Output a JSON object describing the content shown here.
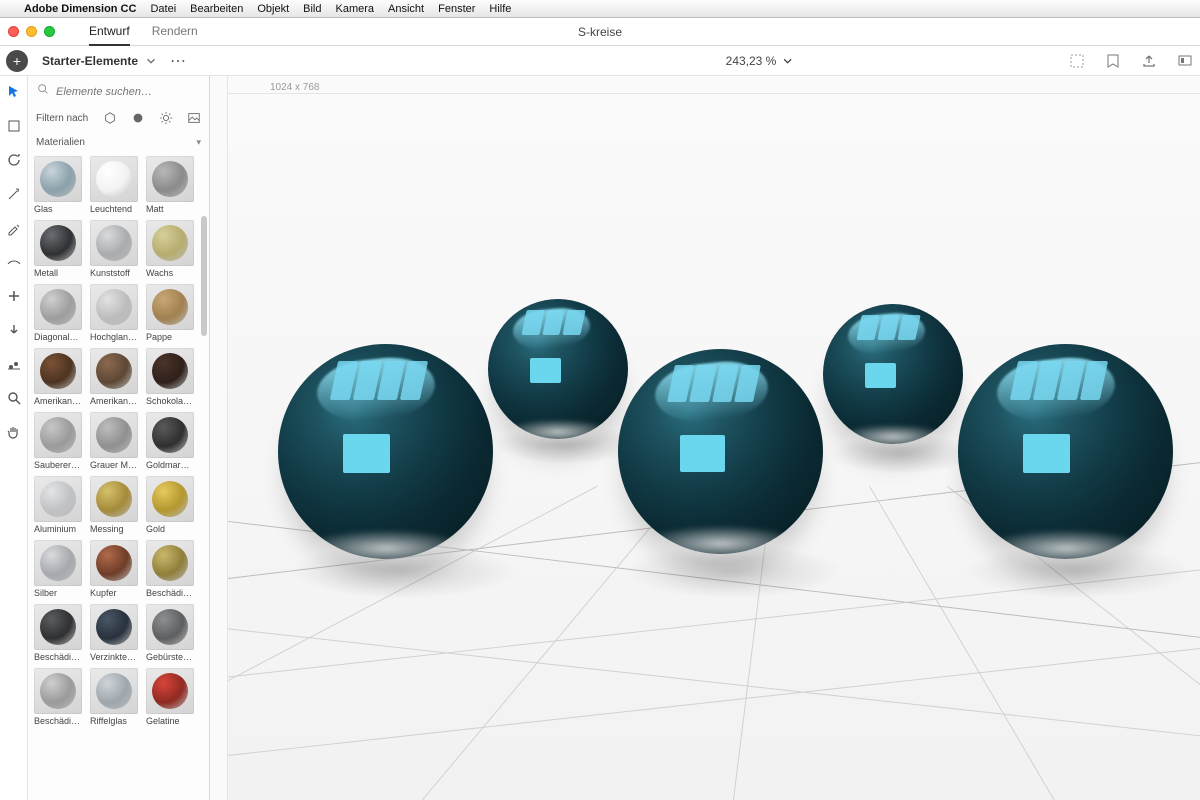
{
  "menubar": {
    "app": "Adobe Dimension CC",
    "items": [
      "Datei",
      "Bearbeiten",
      "Objekt",
      "Bild",
      "Kamera",
      "Ansicht",
      "Fenster",
      "Hilfe"
    ]
  },
  "tabs": {
    "design": "Entwurf",
    "render": "Rendern"
  },
  "document_title": "S-kreise",
  "panel": {
    "title": "Starter-Elemente",
    "search_placeholder": "Elemente suchen…",
    "filter_label": "Filtern nach",
    "section": "Materialien"
  },
  "zoom": "243,23 %",
  "canvas_size": "1024 x 768",
  "materials": [
    {
      "label": "Glas",
      "c1": "#c9d4da",
      "c2": "#8aa0ab"
    },
    {
      "label": "Leuchtend",
      "c1": "#ffffff",
      "c2": "#f2f2f2"
    },
    {
      "label": "Matt",
      "c1": "#b8b8b8",
      "c2": "#8a8a8a"
    },
    {
      "label": "Metall",
      "c1": "#6b6e72",
      "c2": "#2e3033"
    },
    {
      "label": "Kunststoff",
      "c1": "#d9dadc",
      "c2": "#a9abae"
    },
    {
      "label": "Wachs",
      "c1": "#d7cf9a",
      "c2": "#b6ac6f"
    },
    {
      "label": "Diagonalp…",
      "c1": "#cfcfcf",
      "c2": "#9d9d9d"
    },
    {
      "label": "Hochglan…",
      "c1": "#e2e2e2",
      "c2": "#bcbcbc"
    },
    {
      "label": "Pappe",
      "c1": "#c9a878",
      "c2": "#a0804f"
    },
    {
      "label": "Amerikan…",
      "c1": "#7a5236",
      "c2": "#4d3320"
    },
    {
      "label": "Amerikan…",
      "c1": "#8a6a4f",
      "c2": "#5d4734"
    },
    {
      "label": "Schokola…",
      "c1": "#4a342a",
      "c2": "#2e2019"
    },
    {
      "label": "Sauberer …",
      "c1": "#c7c7c7",
      "c2": "#9a9a9a"
    },
    {
      "label": "Grauer M…",
      "c1": "#bdbdbd",
      "c2": "#8f8f8f"
    },
    {
      "label": "Goldmar…",
      "c1": "#5a5a5a",
      "c2": "#2f2f2f"
    },
    {
      "label": "Aluminium",
      "c1": "#e3e4e6",
      "c2": "#bfc1c4"
    },
    {
      "label": "Messing",
      "c1": "#d6c06a",
      "c2": "#a38a3a"
    },
    {
      "label": "Gold",
      "c1": "#e6c95e",
      "c2": "#b4962f"
    },
    {
      "label": "Silber",
      "c1": "#d9dbde",
      "c2": "#a5a8ac"
    },
    {
      "label": "Kupfer",
      "c1": "#b06a4a",
      "c2": "#6e3d28"
    },
    {
      "label": "Beschädig…",
      "c1": "#c9b86a",
      "c2": "#8f7e3a"
    },
    {
      "label": "Beschädig…",
      "c1": "#5a5c5e",
      "c2": "#2f3032"
    },
    {
      "label": "Verzinkte…",
      "c1": "#4a5766",
      "c2": "#28313c"
    },
    {
      "label": "Gebürstet…",
      "c1": "#8d8f91",
      "c2": "#5c5e60"
    },
    {
      "label": "Beschädig…",
      "c1": "#cfcfcf",
      "c2": "#9a9a9a"
    },
    {
      "label": "Riffelglas",
      "c1": "#cfd4d8",
      "c2": "#9ea6ac"
    },
    {
      "label": "Gelatine",
      "c1": "#d8453a",
      "c2": "#8f2a22"
    }
  ]
}
